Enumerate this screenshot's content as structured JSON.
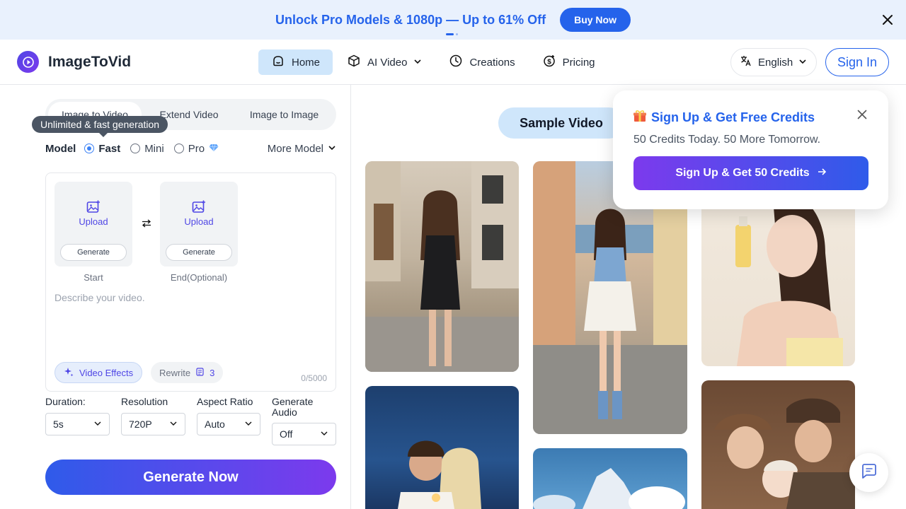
{
  "promo": {
    "text": "Unlock Pro Models & 1080p — Up to 61% Off",
    "button": "Buy Now"
  },
  "header": {
    "brand": "ImageToVid",
    "nav": [
      {
        "label": "Home",
        "icon": "home-icon"
      },
      {
        "label": "AI Video",
        "icon": "cube-icon"
      },
      {
        "label": "Creations",
        "icon": "clock-icon"
      },
      {
        "label": "Pricing",
        "icon": "dollar-badge-icon"
      }
    ],
    "language": "English",
    "signin": "Sign In"
  },
  "tabs": [
    "Image to Video",
    "Extend Video",
    "Image to Image"
  ],
  "tooltip": "Unlimited & fast generation",
  "model": {
    "label": "Model",
    "options": [
      "Fast",
      "Mini",
      "Pro"
    ],
    "selected": "Fast",
    "more": "More Model"
  },
  "upload": {
    "label": "Upload",
    "generate": "Generate",
    "start_caption": "Start",
    "end_caption": "End(Optional)"
  },
  "prompt": {
    "placeholder": "Describe your video.",
    "effects": "Video Effects",
    "rewrite": "Rewrite",
    "rewrite_count": "3",
    "counter": "0/5000"
  },
  "options": {
    "duration_label": "Duration:",
    "duration": "5s",
    "resolution_label": "Resolution",
    "resolution": "720P",
    "aspect_label": "Aspect Ratio",
    "aspect": "Auto",
    "audio_label_1": "Generate",
    "audio_label_2": "Audio",
    "audio": "Off"
  },
  "generate_button": "Generate Now",
  "gallery": {
    "pill": "Sample Video"
  },
  "signup_popup": {
    "title": "Sign Up & Get Free Credits",
    "subtitle": "50 Credits Today. 50 More Tomorrow.",
    "button": "Sign Up & Get 50 Credits"
  },
  "colors": {
    "accent": "#2563eb",
    "promo_bg": "#e9f1fd",
    "gradient_start": "#2f5bea",
    "gradient_end": "#7c3aed"
  }
}
